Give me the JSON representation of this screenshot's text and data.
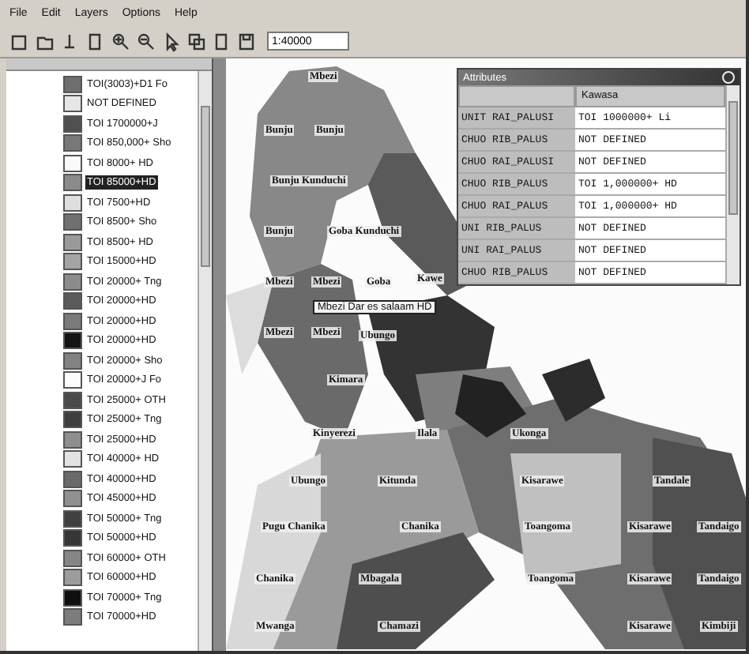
{
  "menu": [
    "File",
    "Edit",
    "Layers",
    "Options",
    "Help"
  ],
  "toolbar": {
    "scale_value": "1:40000"
  },
  "legend": [
    {
      "label": "TOI(3003)+D1 Fo",
      "color": "#6e6e6e",
      "selected": false
    },
    {
      "label": "NOT DEFINED",
      "color": "#e6e6e6",
      "selected": false
    },
    {
      "label": "TOI 1700000+J",
      "color": "#505050",
      "selected": false
    },
    {
      "label": "TOI 850,000+ Sho",
      "color": "#787878",
      "selected": false
    },
    {
      "label": "TOI 8000+ HD",
      "color": "#fafafa",
      "selected": false
    },
    {
      "label": "TOI 85000+HD",
      "color": "#8a8a8a",
      "selected": true
    },
    {
      "label": "TOI 7500+HD",
      "color": "#dedede",
      "selected": false
    },
    {
      "label": "TOI 8500+ Sho",
      "color": "#707070",
      "selected": false
    },
    {
      "label": "TOI 8500+ HD",
      "color": "#9a9a9a",
      "selected": false
    },
    {
      "label": "TOI 15000+HD",
      "color": "#a4a4a4",
      "selected": false
    },
    {
      "label": "TOI 20000+ Tng",
      "color": "#8c8c8c",
      "selected": false
    },
    {
      "label": "TOI 20000+HD",
      "color": "#5a5a5a",
      "selected": false
    },
    {
      "label": "TOI 20000+HD",
      "color": "#7a7a7a",
      "selected": false
    },
    {
      "label": "TOI 20000+HD",
      "color": "#141414",
      "selected": false
    },
    {
      "label": "TOI 20000+ Sho",
      "color": "#828282",
      "selected": false
    },
    {
      "label": "TOI 20000+J Fo",
      "color": "#fcfcfc",
      "selected": false
    },
    {
      "label": "TOI 25000+ OTH",
      "color": "#4a4a4a",
      "selected": false
    },
    {
      "label": "TOI 25000+ Tng",
      "color": "#3e3e3e",
      "selected": false
    },
    {
      "label": "TOI 25000+HD",
      "color": "#8e8e8e",
      "selected": false
    },
    {
      "label": "TOI 40000+ HD",
      "color": "#e2e2e2",
      "selected": false
    },
    {
      "label": "TOI 40000+HD",
      "color": "#6a6a6a",
      "selected": false
    },
    {
      "label": "TOI 45000+HD",
      "color": "#909090",
      "selected": false
    },
    {
      "label": "TOI 50000+ Tng",
      "color": "#404040",
      "selected": false
    },
    {
      "label": "TOI 50000+HD",
      "color": "#363636",
      "selected": false
    },
    {
      "label": "TOI 60000+ OTH",
      "color": "#868686",
      "selected": false
    },
    {
      "label": "TOI 60000+HD",
      "color": "#9c9c9c",
      "selected": false
    },
    {
      "label": "TOI 70000+ Tng",
      "color": "#101010",
      "selected": false
    },
    {
      "label": "TOI 70000+HD",
      "color": "#7c7c7c",
      "selected": false
    }
  ],
  "map": {
    "labels": [
      "Mbezi",
      "Bunju",
      "Bunju",
      "Bunju Kunduchi",
      "Bunju",
      "Goba Kunduchi",
      "Mbezi",
      "Mbezi",
      "Goba",
      "Kawe",
      "Mbezi",
      "Mbezi",
      "Ubungo",
      "Kimara",
      "Kinyerezi",
      "Ilala",
      "Ukonga",
      "Ubungo",
      "Kitunda",
      "Kisarawe",
      "Tandale",
      "Pugu Chanika",
      "Chanika",
      "Toangoma",
      "Kisarawe",
      "Tandaigo",
      "Chanika",
      "Mbagala",
      "Toangoma",
      "Kisarawe",
      "Tandaigo",
      "Mwanga",
      "Chamazi",
      "Kisarawe",
      "Kimbiji"
    ],
    "tooltip": "Mbezi Dar es salaam HD"
  },
  "attributes": {
    "title": "Attributes",
    "column_header": "Kawasa",
    "rows": [
      {
        "column_1": "UNIT RAI_PALUSI",
        "column_2": "TOI 1000000+ Li"
      },
      {
        "column_1": "CHUO RIB_PALUS",
        "column_2": "NOT DEFINED"
      },
      {
        "column_1": "CHUO RAI_PALUSI",
        "column_2": "NOT DEFINED"
      },
      {
        "column_1": "CHUO RIB_PALUS",
        "column_2": "TOI 1,000000+ HD"
      },
      {
        "column_1": "CHUO RAI_PALUS",
        "column_2": "TOI 1,000000+ HD"
      },
      {
        "column_1": "UNI RIB_PALUS",
        "column_2": "NOT DEFINED"
      },
      {
        "column_1": "UNI RAI_PALUS",
        "column_2": "NOT DEFINED"
      },
      {
        "column_1": "CHUO RIB_PALUS",
        "column_2": "NOT DEFINED"
      }
    ]
  }
}
